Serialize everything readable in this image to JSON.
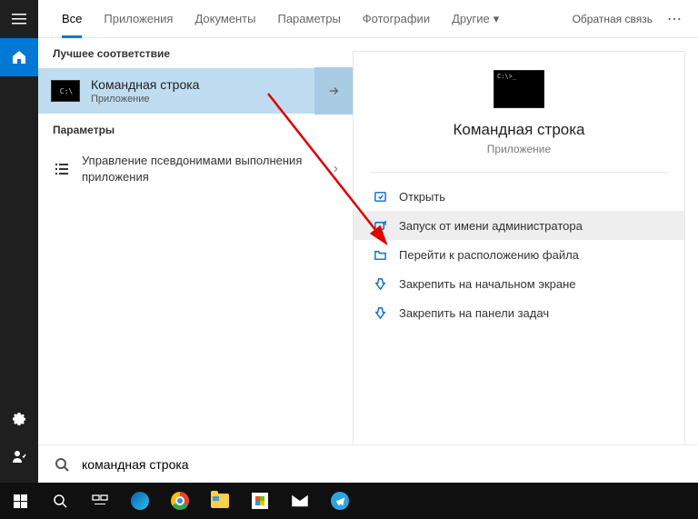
{
  "tabs": {
    "all": "Все",
    "apps": "Приложения",
    "docs": "Документы",
    "settings": "Параметры",
    "photos": "Фотографии",
    "other": "Другие"
  },
  "top_right": {
    "feedback": "Обратная связь"
  },
  "left": {
    "best_header": "Лучшее соответствие",
    "best_title": "Командная строка",
    "best_sub": "Приложение",
    "settings_header": "Параметры",
    "settings_item": "Управление псевдонимами выполнения приложения"
  },
  "right": {
    "title": "Командная строка",
    "sub": "Приложение",
    "actions": {
      "open": "Открыть",
      "run_admin": "Запуск от имени администратора",
      "open_location": "Перейти к расположению файла",
      "pin_start": "Закрепить на начальном экране",
      "pin_taskbar": "Закрепить на панели задач"
    }
  },
  "search": {
    "value": "командная строка"
  }
}
